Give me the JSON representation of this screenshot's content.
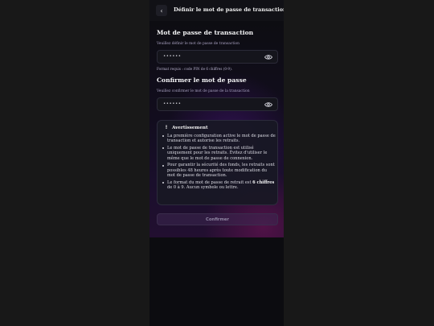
{
  "header": {
    "back_icon": "chevron-left-icon",
    "title": "Définir le mot de passe de transaction"
  },
  "password": {
    "title": "Mot de passe de transaction",
    "hint": "Veuillez définir le mot de passe de transaction",
    "value": "••••••",
    "toggle_icon": "eye-icon",
    "format_note": "Format requis : code PIN de 6 chiffres (0-9)."
  },
  "confirm": {
    "title": "Confirmer le mot de passe",
    "hint": "Veuillez confirmer le mot de passe de la transaction",
    "value": "••••••",
    "toggle_icon": "eye-icon"
  },
  "warning": {
    "icon": "exclamation-icon",
    "title": "Avertissement",
    "items": [
      "La première configuration active le mot de passe de transaction et autorise les retraits.",
      "Le mot de passe de transaction est utilisé uniquement pour les retraits. Évitez d'utiliser le même que le mot de passe de connexion.",
      "Pour garantir la sécurité des fonds, les retraits sont possibles 48 heures après toute modification du mot de passe de transaction."
    ],
    "last_item": {
      "prefix": "Le format du mot de passe de retrait est ",
      "bold": "6 chiffres",
      "suffix": " de 0 à 9. Aucun symbole ou lettre."
    }
  },
  "button": {
    "confirm_label": "Confirmer"
  },
  "colors": {
    "background": "#0c0c10",
    "accent_purple": "#3c2850",
    "outer_background": "#181818"
  }
}
